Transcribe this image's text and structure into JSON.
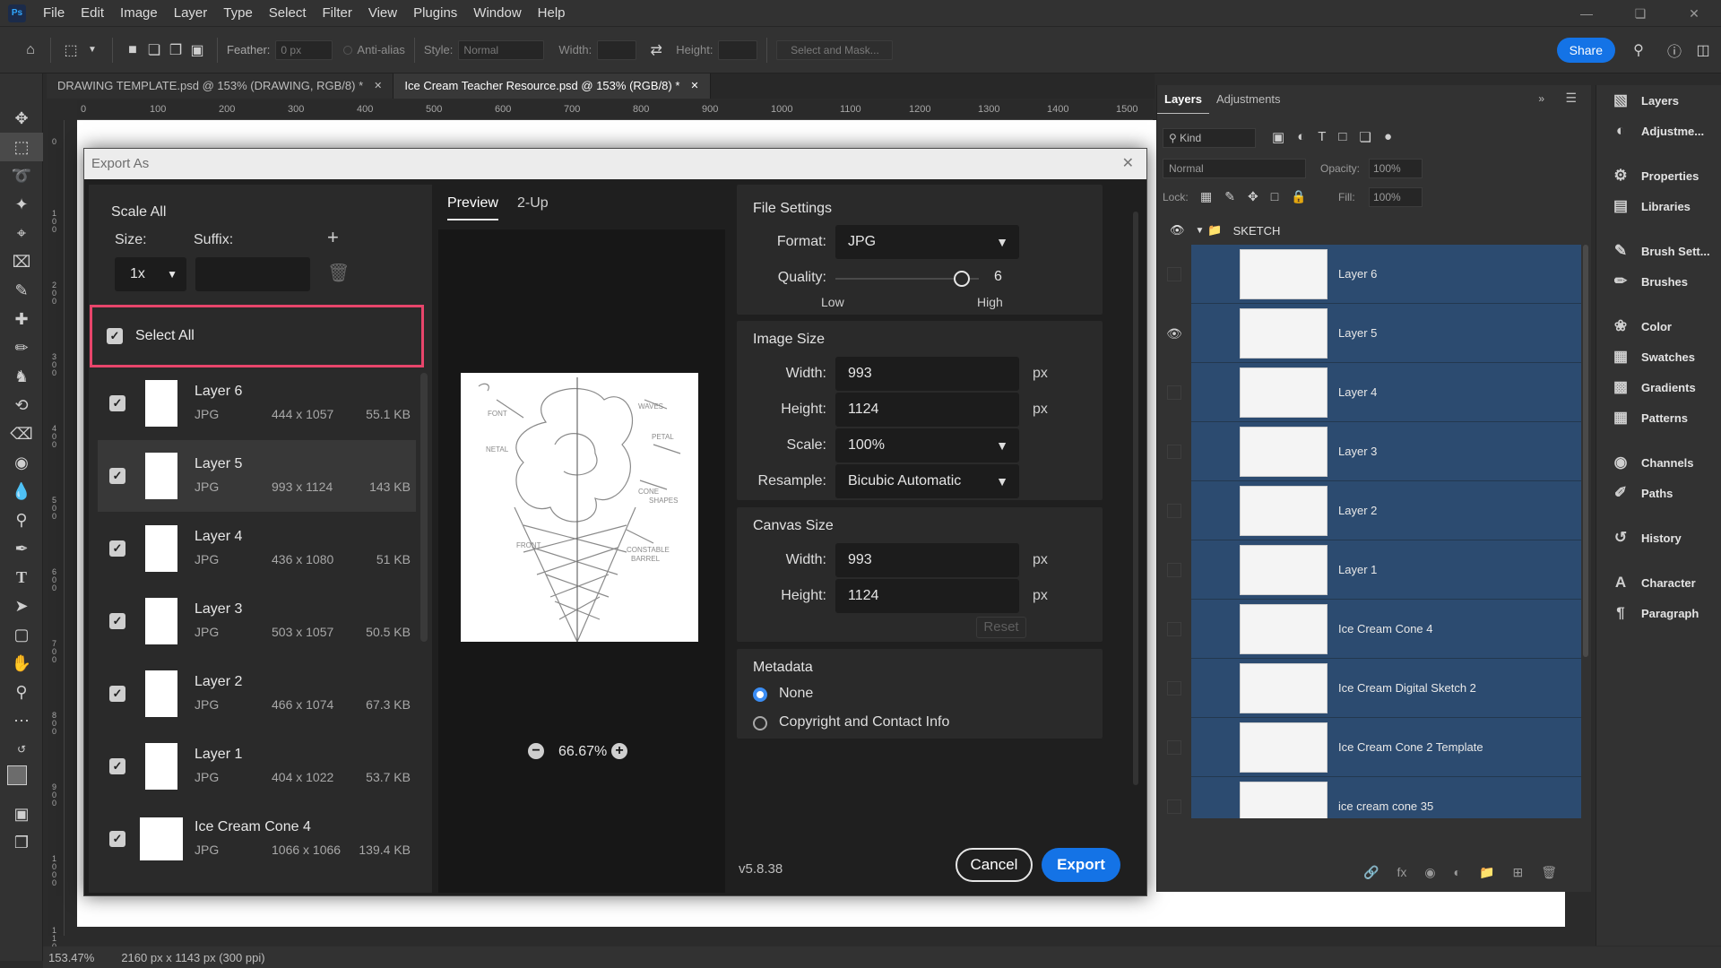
{
  "menu": [
    "File",
    "Edit",
    "Image",
    "Layer",
    "Type",
    "Select",
    "Filter",
    "View",
    "Plugins",
    "Window",
    "Help"
  ],
  "app_logo": "Ps",
  "options_bar": {
    "feather_label": "Feather:",
    "feather_value": "0 px",
    "antialias_label": "Anti-alias",
    "style_label": "Style:",
    "style_value": "Normal",
    "width_label": "Width:",
    "height_label": "Height:",
    "select_mask_label": "Select and Mask...",
    "share_label": "Share"
  },
  "doc_tabs": [
    {
      "label": "DRAWING TEMPLATE.psd @ 153% (DRAWING, RGB/8) *",
      "active": false
    },
    {
      "label": "Ice Cream Teacher Resource.psd @ 153% (RGB/8) *",
      "active": true
    }
  ],
  "ruler_h": [
    "0",
    "100",
    "200",
    "300",
    "400",
    "500",
    "600",
    "700",
    "800",
    "900",
    "1000",
    "1100",
    "1200",
    "1300",
    "1400",
    "1500"
  ],
  "ruler_v": [
    "0",
    "1 0 0",
    "2 0 0",
    "3 0 0",
    "4 0 0",
    "5 0 0",
    "6 0 0",
    "7 0 0",
    "8 0 0",
    "9 0 0",
    "1 0 0 0",
    "1 1 0 0"
  ],
  "status": {
    "zoom": "153.47%",
    "doc_info": "2160 px x 1143 px (300 ppi)"
  },
  "export_dialog": {
    "title": "Export As",
    "scale_all": "Scale All",
    "size_label": "Size:",
    "suffix_label": "Suffix:",
    "size_value": "1x",
    "select_all": "Select All",
    "assets": [
      {
        "name": "Layer 6",
        "format": "JPG",
        "dims": "444 x 1057",
        "size": "55.1 KB",
        "selected": false
      },
      {
        "name": "Layer 5",
        "format": "JPG",
        "dims": "993 x 1124",
        "size": "143 KB",
        "selected": true
      },
      {
        "name": "Layer 4",
        "format": "JPG",
        "dims": "436 x 1080",
        "size": "51 KB",
        "selected": false
      },
      {
        "name": "Layer 3",
        "format": "JPG",
        "dims": "503 x 1057",
        "size": "50.5 KB",
        "selected": false
      },
      {
        "name": "Layer 2",
        "format": "JPG",
        "dims": "466 x 1074",
        "size": "67.3 KB",
        "selected": false
      },
      {
        "name": "Layer 1",
        "format": "JPG",
        "dims": "404 x 1022",
        "size": "53.7 KB",
        "selected": false
      },
      {
        "name": "Ice Cream Cone 4",
        "format": "JPG",
        "dims": "1066 x 1066",
        "size": "139.4 KB",
        "selected": false
      }
    ],
    "preview_tab": "Preview",
    "twoup_tab": "2-Up",
    "zoom": "66.67%",
    "version": "v5.8.38",
    "file_settings": {
      "heading": "File Settings",
      "format_label": "Format:",
      "format_value": "JPG",
      "quality_label": "Quality:",
      "quality_value": "6",
      "quality_level": 0.88,
      "low": "Low",
      "high": "High"
    },
    "image_size": {
      "heading": "Image Size",
      "width_label": "Width:",
      "width_value": "993",
      "height_label": "Height:",
      "height_value": "1124",
      "scale_label": "Scale:",
      "scale_value": "100%",
      "resample_label": "Resample:",
      "resample_value": "Bicubic Automatic",
      "unit": "px"
    },
    "canvas_size": {
      "heading": "Canvas Size",
      "width_label": "Width:",
      "width_value": "993",
      "height_label": "Height:",
      "height_value": "1124",
      "reset_label": "Reset"
    },
    "metadata": {
      "heading": "Metadata",
      "option_none": "None",
      "option_copyright": "Copyright and Contact Info"
    },
    "cancel_label": "Cancel",
    "export_label": "Export"
  },
  "layers_panel": {
    "tabs": [
      "Layers",
      "Adjustments"
    ],
    "kind_label": "Kind",
    "blend_mode": "Normal",
    "opacity_label": "Opacity:",
    "opacity_value": "100%",
    "lock_label": "Lock:",
    "fill_label": "Fill:",
    "fill_value": "100%",
    "group_name": "SKETCH",
    "layers": [
      {
        "name": "Layer 6",
        "visible": false
      },
      {
        "name": "Layer 5",
        "visible": true
      },
      {
        "name": "Layer 4",
        "visible": false
      },
      {
        "name": "Layer 3",
        "visible": false
      },
      {
        "name": "Layer 2",
        "visible": false
      },
      {
        "name": "Layer 1",
        "visible": false
      },
      {
        "name": "Ice Cream Cone 4",
        "visible": false
      },
      {
        "name": "Ice Cream Digital Sketch 2",
        "visible": false
      },
      {
        "name": "Ice Cream Cone 2 Template",
        "visible": false
      },
      {
        "name": "ice cream cone 35",
        "visible": false
      }
    ]
  },
  "right_dock": [
    "Layers",
    "Adjustme...",
    "Properties",
    "Libraries",
    "Brush Sett...",
    "Brushes",
    "Color",
    "Swatches",
    "Gradients",
    "Patterns",
    "Channels",
    "Paths",
    "History",
    "Character",
    "Paragraph"
  ],
  "colors": {
    "accent": "#1473e6",
    "highlight_box": "#e8456b",
    "layer_selected": "#2c4b70"
  }
}
